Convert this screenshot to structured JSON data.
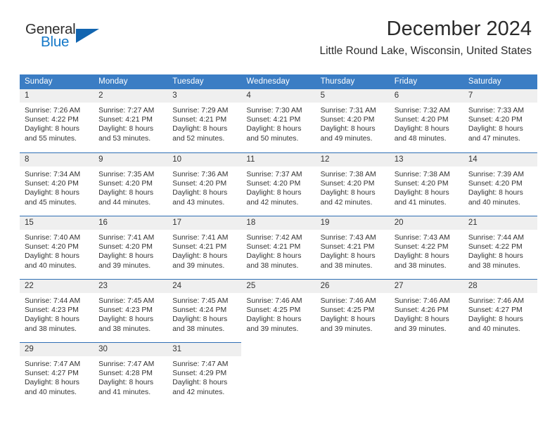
{
  "brand": {
    "name_top": "General",
    "name_bottom": "Blue",
    "triangle_color": "#1265b0",
    "blue_color": "#1478c8"
  },
  "header": {
    "title": "December 2024",
    "subtitle": "Little Round Lake, Wisconsin, United States"
  },
  "theme": {
    "header_bar_color": "#3b7dc4",
    "week_separator_color": "#2f6fb5",
    "daynum_band_color": "#efefef",
    "text_color": "#333333"
  },
  "calendar": {
    "weekday_headers": [
      "Sunday",
      "Monday",
      "Tuesday",
      "Wednesday",
      "Thursday",
      "Friday",
      "Saturday"
    ],
    "weeks": [
      [
        {
          "day": "1",
          "sunrise": "Sunrise: 7:26 AM",
          "sunset": "Sunset: 4:22 PM",
          "daylight_1": "Daylight: 8 hours",
          "daylight_2": "and 55 minutes."
        },
        {
          "day": "2",
          "sunrise": "Sunrise: 7:27 AM",
          "sunset": "Sunset: 4:21 PM",
          "daylight_1": "Daylight: 8 hours",
          "daylight_2": "and 53 minutes."
        },
        {
          "day": "3",
          "sunrise": "Sunrise: 7:29 AM",
          "sunset": "Sunset: 4:21 PM",
          "daylight_1": "Daylight: 8 hours",
          "daylight_2": "and 52 minutes."
        },
        {
          "day": "4",
          "sunrise": "Sunrise: 7:30 AM",
          "sunset": "Sunset: 4:21 PM",
          "daylight_1": "Daylight: 8 hours",
          "daylight_2": "and 50 minutes."
        },
        {
          "day": "5",
          "sunrise": "Sunrise: 7:31 AM",
          "sunset": "Sunset: 4:20 PM",
          "daylight_1": "Daylight: 8 hours",
          "daylight_2": "and 49 minutes."
        },
        {
          "day": "6",
          "sunrise": "Sunrise: 7:32 AM",
          "sunset": "Sunset: 4:20 PM",
          "daylight_1": "Daylight: 8 hours",
          "daylight_2": "and 48 minutes."
        },
        {
          "day": "7",
          "sunrise": "Sunrise: 7:33 AM",
          "sunset": "Sunset: 4:20 PM",
          "daylight_1": "Daylight: 8 hours",
          "daylight_2": "and 47 minutes."
        }
      ],
      [
        {
          "day": "8",
          "sunrise": "Sunrise: 7:34 AM",
          "sunset": "Sunset: 4:20 PM",
          "daylight_1": "Daylight: 8 hours",
          "daylight_2": "and 45 minutes."
        },
        {
          "day": "9",
          "sunrise": "Sunrise: 7:35 AM",
          "sunset": "Sunset: 4:20 PM",
          "daylight_1": "Daylight: 8 hours",
          "daylight_2": "and 44 minutes."
        },
        {
          "day": "10",
          "sunrise": "Sunrise: 7:36 AM",
          "sunset": "Sunset: 4:20 PM",
          "daylight_1": "Daylight: 8 hours",
          "daylight_2": "and 43 minutes."
        },
        {
          "day": "11",
          "sunrise": "Sunrise: 7:37 AM",
          "sunset": "Sunset: 4:20 PM",
          "daylight_1": "Daylight: 8 hours",
          "daylight_2": "and 42 minutes."
        },
        {
          "day": "12",
          "sunrise": "Sunrise: 7:38 AM",
          "sunset": "Sunset: 4:20 PM",
          "daylight_1": "Daylight: 8 hours",
          "daylight_2": "and 42 minutes."
        },
        {
          "day": "13",
          "sunrise": "Sunrise: 7:38 AM",
          "sunset": "Sunset: 4:20 PM",
          "daylight_1": "Daylight: 8 hours",
          "daylight_2": "and 41 minutes."
        },
        {
          "day": "14",
          "sunrise": "Sunrise: 7:39 AM",
          "sunset": "Sunset: 4:20 PM",
          "daylight_1": "Daylight: 8 hours",
          "daylight_2": "and 40 minutes."
        }
      ],
      [
        {
          "day": "15",
          "sunrise": "Sunrise: 7:40 AM",
          "sunset": "Sunset: 4:20 PM",
          "daylight_1": "Daylight: 8 hours",
          "daylight_2": "and 40 minutes."
        },
        {
          "day": "16",
          "sunrise": "Sunrise: 7:41 AM",
          "sunset": "Sunset: 4:20 PM",
          "daylight_1": "Daylight: 8 hours",
          "daylight_2": "and 39 minutes."
        },
        {
          "day": "17",
          "sunrise": "Sunrise: 7:41 AM",
          "sunset": "Sunset: 4:21 PM",
          "daylight_1": "Daylight: 8 hours",
          "daylight_2": "and 39 minutes."
        },
        {
          "day": "18",
          "sunrise": "Sunrise: 7:42 AM",
          "sunset": "Sunset: 4:21 PM",
          "daylight_1": "Daylight: 8 hours",
          "daylight_2": "and 38 minutes."
        },
        {
          "day": "19",
          "sunrise": "Sunrise: 7:43 AM",
          "sunset": "Sunset: 4:21 PM",
          "daylight_1": "Daylight: 8 hours",
          "daylight_2": "and 38 minutes."
        },
        {
          "day": "20",
          "sunrise": "Sunrise: 7:43 AM",
          "sunset": "Sunset: 4:22 PM",
          "daylight_1": "Daylight: 8 hours",
          "daylight_2": "and 38 minutes."
        },
        {
          "day": "21",
          "sunrise": "Sunrise: 7:44 AM",
          "sunset": "Sunset: 4:22 PM",
          "daylight_1": "Daylight: 8 hours",
          "daylight_2": "and 38 minutes."
        }
      ],
      [
        {
          "day": "22",
          "sunrise": "Sunrise: 7:44 AM",
          "sunset": "Sunset: 4:23 PM",
          "daylight_1": "Daylight: 8 hours",
          "daylight_2": "and 38 minutes."
        },
        {
          "day": "23",
          "sunrise": "Sunrise: 7:45 AM",
          "sunset": "Sunset: 4:23 PM",
          "daylight_1": "Daylight: 8 hours",
          "daylight_2": "and 38 minutes."
        },
        {
          "day": "24",
          "sunrise": "Sunrise: 7:45 AM",
          "sunset": "Sunset: 4:24 PM",
          "daylight_1": "Daylight: 8 hours",
          "daylight_2": "and 38 minutes."
        },
        {
          "day": "25",
          "sunrise": "Sunrise: 7:46 AM",
          "sunset": "Sunset: 4:25 PM",
          "daylight_1": "Daylight: 8 hours",
          "daylight_2": "and 39 minutes."
        },
        {
          "day": "26",
          "sunrise": "Sunrise: 7:46 AM",
          "sunset": "Sunset: 4:25 PM",
          "daylight_1": "Daylight: 8 hours",
          "daylight_2": "and 39 minutes."
        },
        {
          "day": "27",
          "sunrise": "Sunrise: 7:46 AM",
          "sunset": "Sunset: 4:26 PM",
          "daylight_1": "Daylight: 8 hours",
          "daylight_2": "and 39 minutes."
        },
        {
          "day": "28",
          "sunrise": "Sunrise: 7:46 AM",
          "sunset": "Sunset: 4:27 PM",
          "daylight_1": "Daylight: 8 hours",
          "daylight_2": "and 40 minutes."
        }
      ],
      [
        {
          "day": "29",
          "sunrise": "Sunrise: 7:47 AM",
          "sunset": "Sunset: 4:27 PM",
          "daylight_1": "Daylight: 8 hours",
          "daylight_2": "and 40 minutes."
        },
        {
          "day": "30",
          "sunrise": "Sunrise: 7:47 AM",
          "sunset": "Sunset: 4:28 PM",
          "daylight_1": "Daylight: 8 hours",
          "daylight_2": "and 41 minutes."
        },
        {
          "day": "31",
          "sunrise": "Sunrise: 7:47 AM",
          "sunset": "Sunset: 4:29 PM",
          "daylight_1": "Daylight: 8 hours",
          "daylight_2": "and 42 minutes."
        },
        {
          "day": "",
          "sunrise": "",
          "sunset": "",
          "daylight_1": "",
          "daylight_2": ""
        },
        {
          "day": "",
          "sunrise": "",
          "sunset": "",
          "daylight_1": "",
          "daylight_2": ""
        },
        {
          "day": "",
          "sunrise": "",
          "sunset": "",
          "daylight_1": "",
          "daylight_2": ""
        },
        {
          "day": "",
          "sunrise": "",
          "sunset": "",
          "daylight_1": "",
          "daylight_2": ""
        }
      ]
    ]
  }
}
